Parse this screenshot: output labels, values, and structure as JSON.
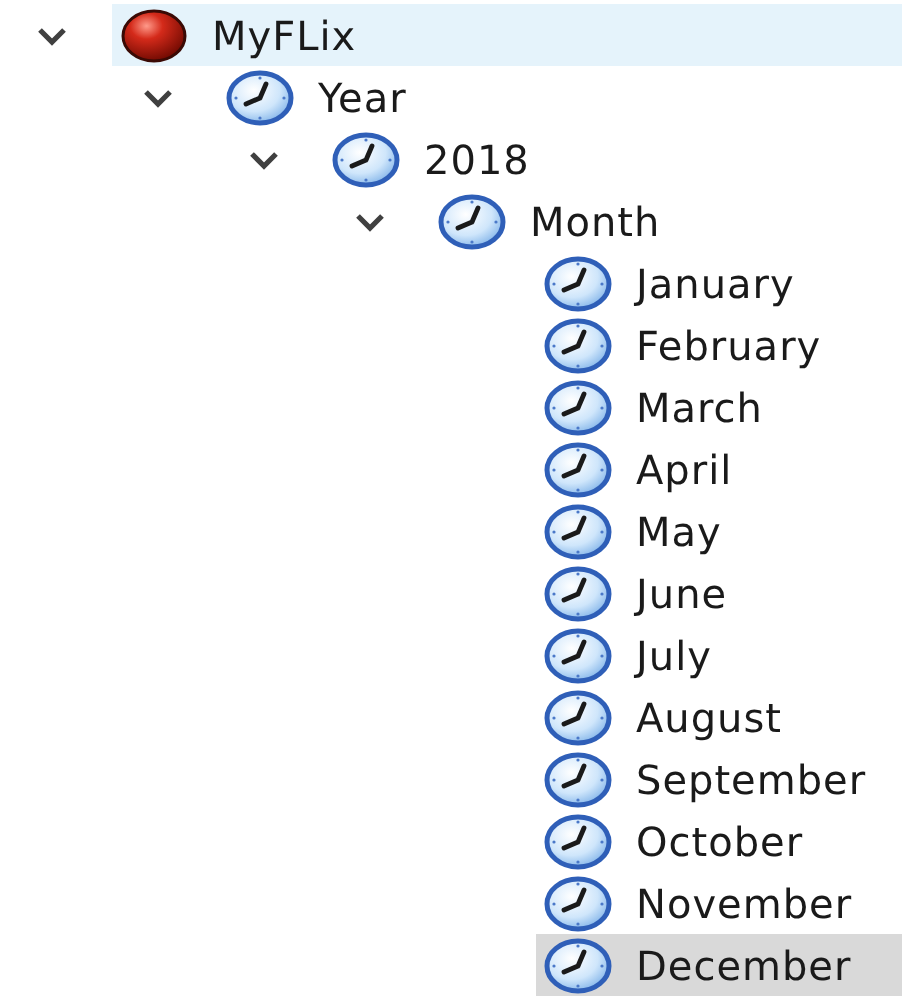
{
  "tree": [
    {
      "label": "MyFLix",
      "kind": "root",
      "expanded": true,
      "selected": false,
      "hovered": true,
      "children": [
        {
          "label": "Year",
          "kind": "clock",
          "expanded": true,
          "selected": false,
          "hovered": false,
          "children": [
            {
              "label": "2018",
              "kind": "clock",
              "expanded": true,
              "selected": false,
              "hovered": false,
              "children": [
                {
                  "label": "Month",
                  "kind": "clock",
                  "expanded": true,
                  "selected": false,
                  "hovered": false,
                  "children": [
                    {
                      "label": "January",
                      "kind": "clock",
                      "selected": false,
                      "hovered": false
                    },
                    {
                      "label": "February",
                      "kind": "clock",
                      "selected": false,
                      "hovered": false
                    },
                    {
                      "label": "March",
                      "kind": "clock",
                      "selected": false,
                      "hovered": false
                    },
                    {
                      "label": "April",
                      "kind": "clock",
                      "selected": false,
                      "hovered": false
                    },
                    {
                      "label": "May",
                      "kind": "clock",
                      "selected": false,
                      "hovered": false
                    },
                    {
                      "label": "June",
                      "kind": "clock",
                      "selected": false,
                      "hovered": false
                    },
                    {
                      "label": "July",
                      "kind": "clock",
                      "selected": false,
                      "hovered": false
                    },
                    {
                      "label": "August",
                      "kind": "clock",
                      "selected": false,
                      "hovered": false
                    },
                    {
                      "label": "September",
                      "kind": "clock",
                      "selected": false,
                      "hovered": false
                    },
                    {
                      "label": "October",
                      "kind": "clock",
                      "selected": false,
                      "hovered": false
                    },
                    {
                      "label": "November",
                      "kind": "clock",
                      "selected": false,
                      "hovered": false
                    },
                    {
                      "label": "December",
                      "kind": "clock",
                      "selected": true,
                      "hovered": false
                    }
                  ]
                }
              ]
            }
          ]
        }
      ]
    }
  ]
}
